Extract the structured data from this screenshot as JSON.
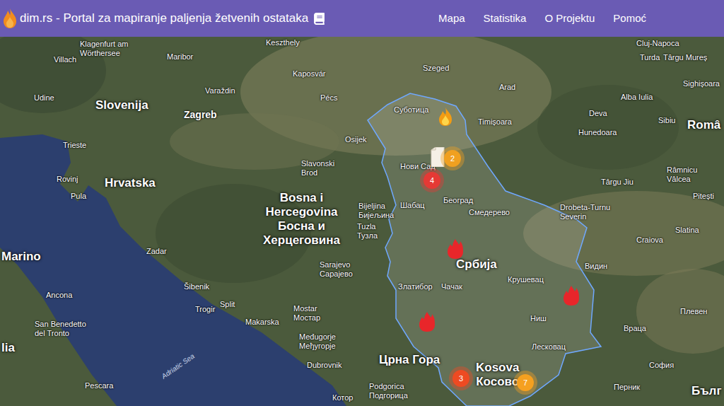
{
  "header": {
    "title": "dim.rs - Portal za mapiranje paljenja žetvenih ostataka",
    "nav": [
      {
        "label": "Mapa"
      },
      {
        "label": "Statistika"
      },
      {
        "label": "O Projektu"
      },
      {
        "label": "Pomoć"
      }
    ]
  },
  "map": {
    "labels": [
      {
        "text": "Klagenfurt am\nWörthersee",
        "kind": "city"
      },
      {
        "text": "Keszthely",
        "kind": "city"
      },
      {
        "text": "Villach",
        "kind": "city"
      },
      {
        "text": "Maribor",
        "kind": "city"
      },
      {
        "text": "Kaposvár",
        "kind": "city"
      },
      {
        "text": "Szeged",
        "kind": "city"
      },
      {
        "text": "Cluj-Napoca",
        "kind": "city"
      },
      {
        "text": "Turda",
        "kind": "city"
      },
      {
        "text": "Târgu Mureș",
        "kind": "city"
      },
      {
        "text": "Arad",
        "kind": "city"
      },
      {
        "text": "Varaždin",
        "kind": "city"
      },
      {
        "text": "Udine",
        "kind": "city"
      },
      {
        "text": "Pécs",
        "kind": "city"
      },
      {
        "text": "Sighișoara",
        "kind": "city"
      },
      {
        "text": "Alba Iulia",
        "kind": "city"
      },
      {
        "text": "Slovenija",
        "kind": "country"
      },
      {
        "text": "Zagreb",
        "kind": "capital"
      },
      {
        "text": "Суботица",
        "kind": "city"
      },
      {
        "text": "Deva",
        "kind": "city"
      },
      {
        "text": "Timișoara",
        "kind": "city"
      },
      {
        "text": "Sibiu",
        "kind": "city"
      },
      {
        "text": "Româ",
        "kind": "country"
      },
      {
        "text": "Hunedoara",
        "kind": "city"
      },
      {
        "text": "Osijek",
        "kind": "city"
      },
      {
        "text": "Trieste",
        "kind": "city"
      },
      {
        "text": "Slavonski\nBrod",
        "kind": "city"
      },
      {
        "text": "Нови Сад",
        "kind": "city"
      },
      {
        "text": "Râmnicu\nVâlcea",
        "kind": "city"
      },
      {
        "text": "Rovinj",
        "kind": "city"
      },
      {
        "text": "Hrvatska",
        "kind": "country"
      },
      {
        "text": "Târgu Jiu",
        "kind": "city"
      },
      {
        "text": "Pula",
        "kind": "city"
      },
      {
        "text": "Pitești",
        "kind": "city"
      },
      {
        "text": "Bosna i\nHercegovina\nБосна и\nХерцеговина",
        "kind": "country"
      },
      {
        "text": "Bijeljina\nБијељина",
        "kind": "city"
      },
      {
        "text": "Шабац",
        "kind": "city"
      },
      {
        "text": "Београд",
        "kind": "city"
      },
      {
        "text": "Drobeta-Turnu\nSeverin",
        "kind": "city"
      },
      {
        "text": "Смедерево",
        "kind": "city"
      },
      {
        "text": "Tuzla\nТузла",
        "kind": "city"
      },
      {
        "text": "Slatina",
        "kind": "city"
      },
      {
        "text": "Craiova",
        "kind": "city"
      },
      {
        "text": "Marino",
        "kind": "country"
      },
      {
        "text": "Zadar",
        "kind": "city"
      },
      {
        "text": "Sarajevo\nСарајево",
        "kind": "city"
      },
      {
        "text": "Србија",
        "kind": "country"
      },
      {
        "text": "Видин",
        "kind": "city"
      },
      {
        "text": "Šibenik",
        "kind": "city"
      },
      {
        "text": "Златибор",
        "kind": "city"
      },
      {
        "text": "Чачак",
        "kind": "city"
      },
      {
        "text": "Крушевац",
        "kind": "city"
      },
      {
        "text": "Ancona",
        "kind": "city"
      },
      {
        "text": "Split",
        "kind": "city"
      },
      {
        "text": "Trogir",
        "kind": "city"
      },
      {
        "text": "Mostar\nМостар",
        "kind": "city"
      },
      {
        "text": "Плевен",
        "kind": "city"
      },
      {
        "text": "Ниш",
        "kind": "city"
      },
      {
        "text": "Makarska",
        "kind": "city"
      },
      {
        "text": "San Benedetto\ndel Tronto",
        "kind": "city"
      },
      {
        "text": "Враца",
        "kind": "city"
      },
      {
        "text": "Međugorje\nМеђугорје",
        "kind": "city"
      },
      {
        "text": "Лесковац",
        "kind": "city"
      },
      {
        "text": "Dubrovnik",
        "kind": "city"
      },
      {
        "text": "Црна Гора",
        "kind": "country"
      },
      {
        "text": "София",
        "kind": "city"
      },
      {
        "text": "Kosova\nКосово",
        "kind": "country"
      },
      {
        "text": "Pescara",
        "kind": "city"
      },
      {
        "text": "Podgorica\nПодгорица",
        "kind": "city"
      },
      {
        "text": "Котор",
        "kind": "city"
      },
      {
        "text": "Перник",
        "kind": "city"
      },
      {
        "text": "Бълг",
        "kind": "country"
      },
      {
        "text": "lia",
        "kind": "country"
      },
      {
        "text": "Adriatic Sea",
        "kind": "sea"
      }
    ],
    "markers": [
      {
        "kind": "flame",
        "color": "#f39c12"
      },
      {
        "kind": "document",
        "color": "#f5f0e6"
      },
      {
        "kind": "cluster",
        "count": "2",
        "color": "#f0a020"
      },
      {
        "kind": "cluster",
        "count": "4",
        "color": "#e53935"
      },
      {
        "kind": "fire",
        "color": "#e8262a"
      },
      {
        "kind": "fire",
        "color": "#e8262a"
      },
      {
        "kind": "fire",
        "color": "#e8262a"
      },
      {
        "kind": "cluster",
        "count": "3",
        "color": "#ee4a22"
      },
      {
        "kind": "cluster",
        "count": "7",
        "color": "#f5a020"
      }
    ]
  }
}
